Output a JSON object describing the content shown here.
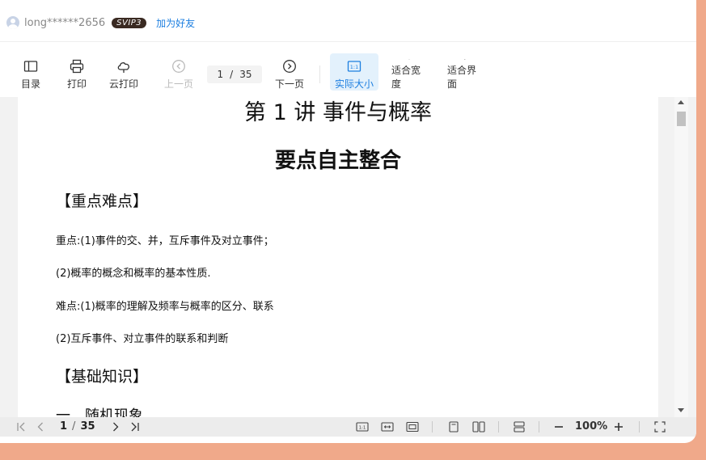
{
  "user": {
    "name": "long******2656",
    "badge": "SVIP3",
    "add_friend": "加为好友"
  },
  "toolbar": {
    "toc": "目录",
    "print": "打印",
    "cloud_print": "云打印",
    "prev_page": "上一页",
    "current_page": "1",
    "page_sep": "/",
    "total_pages": "35",
    "next_page": "下一页",
    "actual_size": "实际大小",
    "fit_width": "适合宽度",
    "fit_page": "适合界面"
  },
  "document": {
    "title": "第 1 讲 事件与概率",
    "subtitle": "要点自主整合",
    "section1": "【重点难点】",
    "line1": "重点:(1)事件的交、并，互斥事件及对立事件；",
    "line2": "(2)概率的概念和概率的基本性质.",
    "line3": "难点:(1)概率的理解及频率与概率的区分、联系",
    "line4": "(2)互斥事件、对立事件的联系和判断",
    "section2": "【基础知识】",
    "line5": "一、随机现象"
  },
  "bottombar": {
    "current_page": "1",
    "page_sep": "/",
    "total_pages": "35",
    "zoom": "100%"
  },
  "colors": {
    "accent": "#1d7fe0",
    "outer_bg": "#f0a98a",
    "badge_bg": "#3a2a22"
  }
}
